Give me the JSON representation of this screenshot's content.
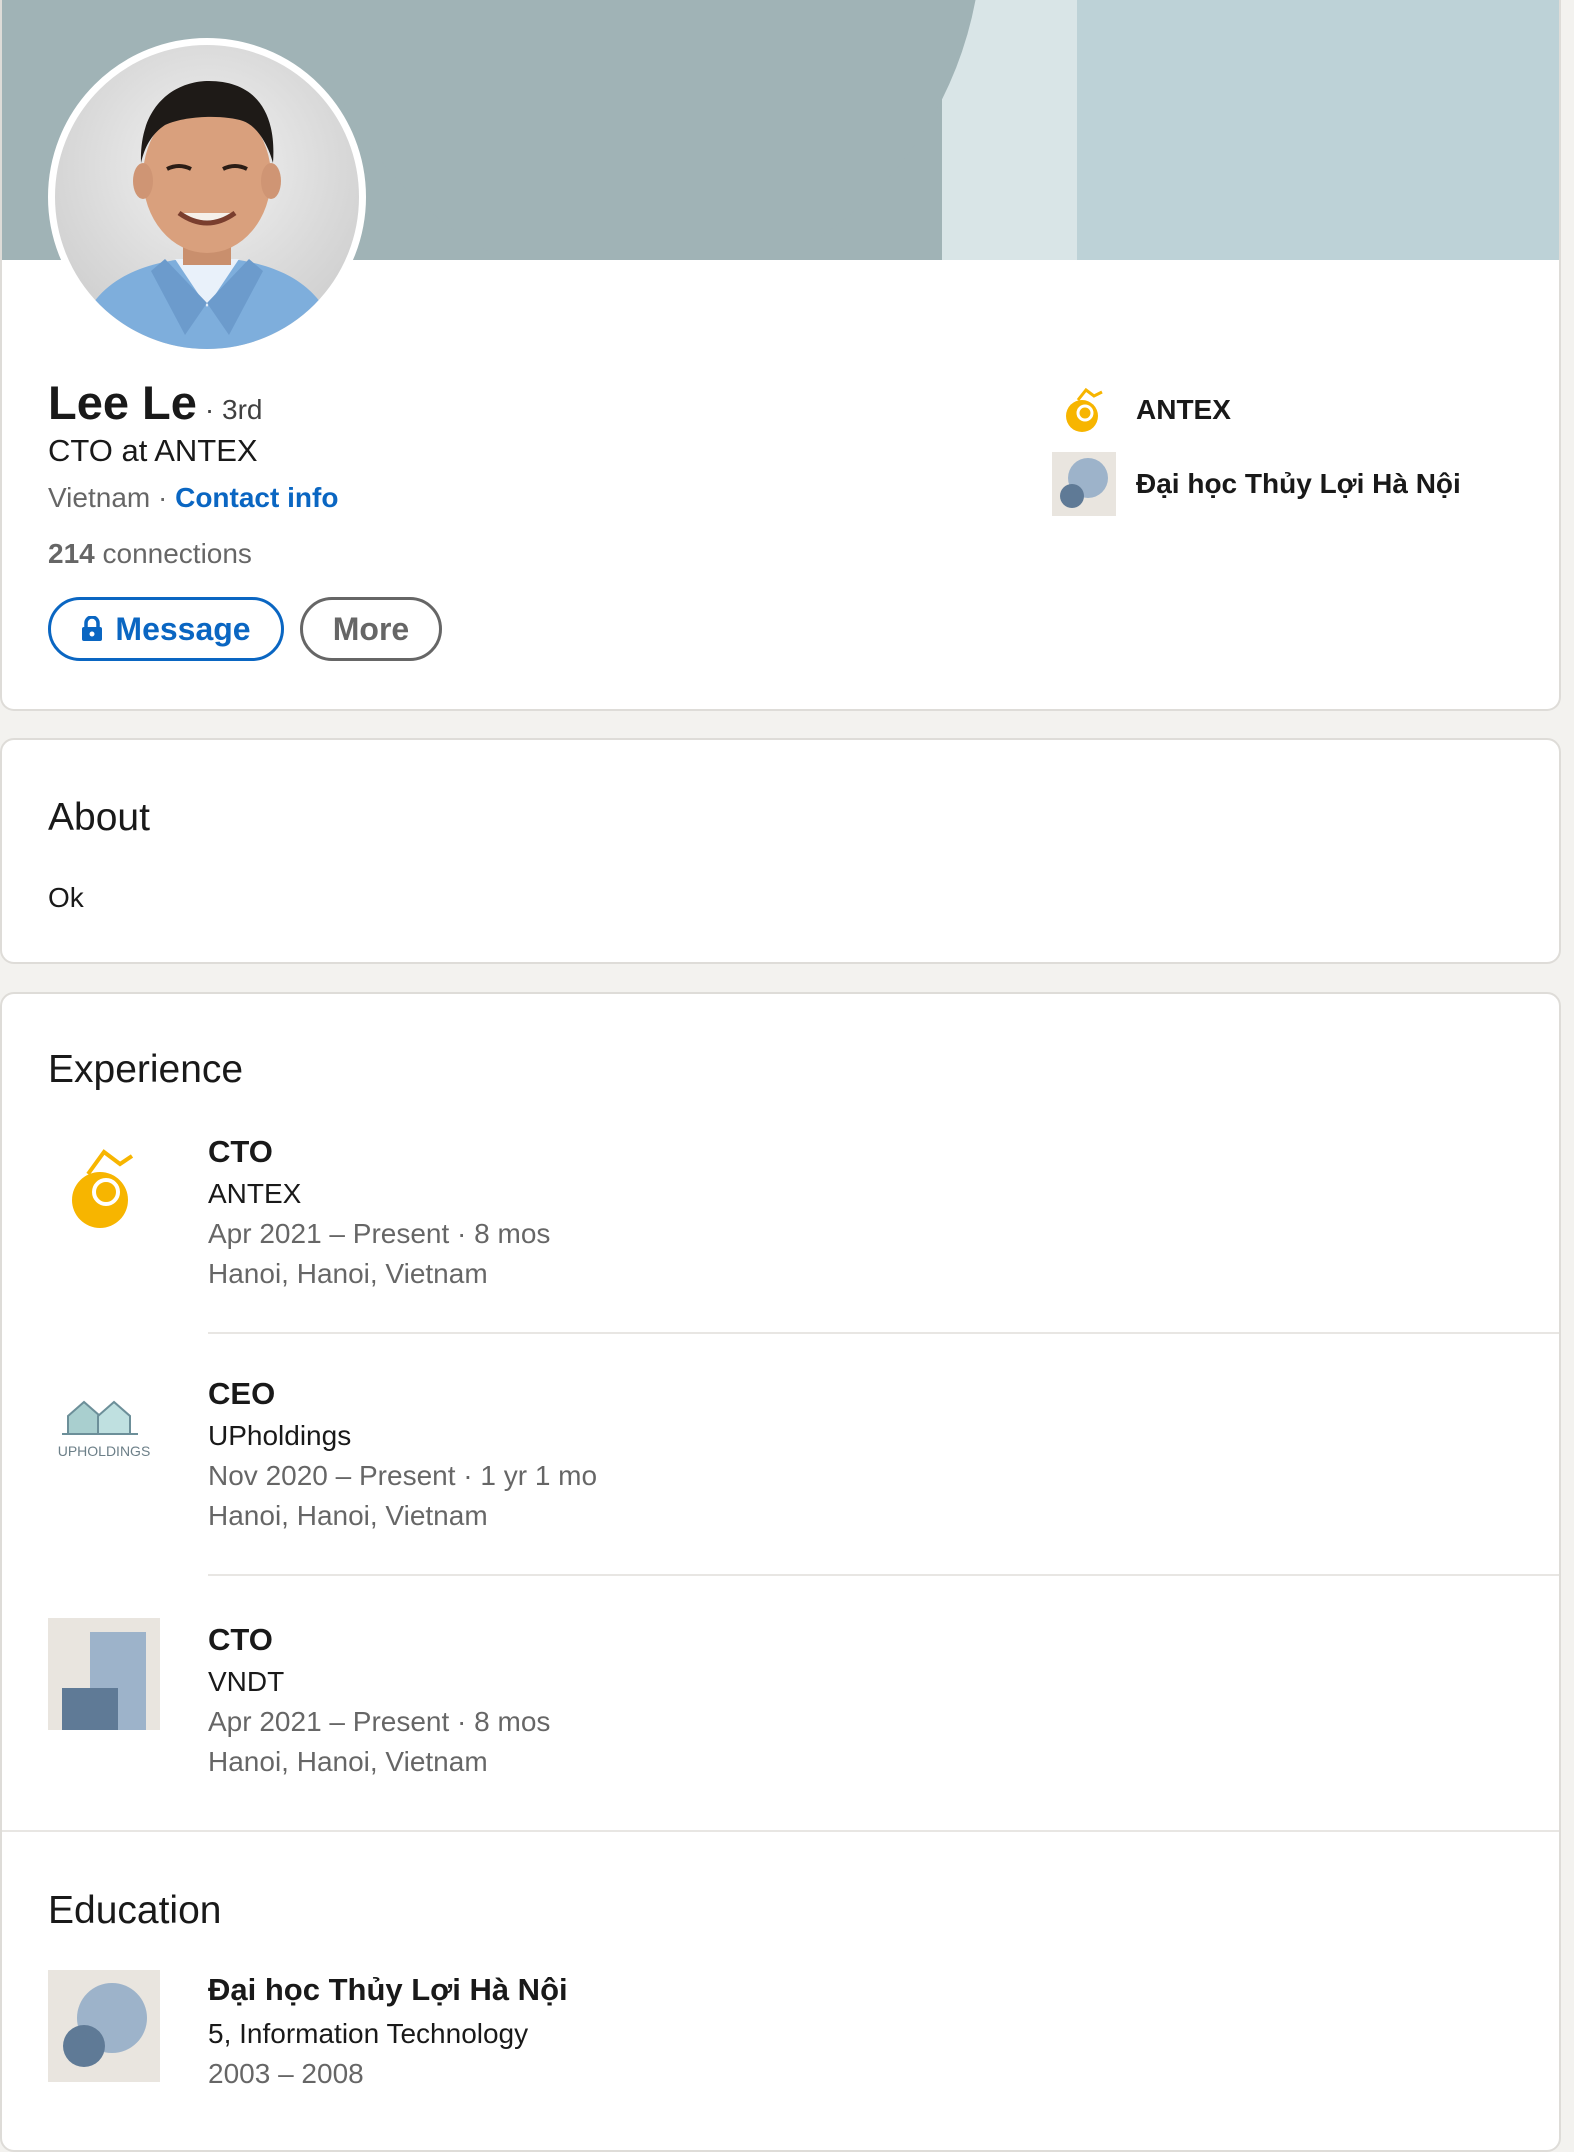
{
  "profile": {
    "name": "Lee Le",
    "degree": "· 3rd",
    "headline": "CTO at ANTEX",
    "location": "Vietnam ·",
    "contact_info": "Contact info",
    "connections_count": "214",
    "connections_label": "connections",
    "message_label": "Message",
    "more_label": "More"
  },
  "affiliations": [
    {
      "label": "ANTEX",
      "logo": "antex-logo"
    },
    {
      "label": "Đại học Thủy Lợi Hà Nội",
      "logo": "school-logo"
    }
  ],
  "about": {
    "title": "About",
    "text": "Ok"
  },
  "experience": {
    "title": "Experience",
    "items": [
      {
        "role": "CTO",
        "org": "ANTEX",
        "dates": "Apr 2021 – Present · 8 mos",
        "place": "Hanoi, Hanoi, Vietnam",
        "logo": "antex-logo"
      },
      {
        "role": "CEO",
        "org": "UPholdings",
        "dates": "Nov 2020 – Present · 1 yr 1 mo",
        "place": "Hanoi, Hanoi, Vietnam",
        "logo": "upholdings-logo",
        "logo_text": "UPHOLDINGS"
      },
      {
        "role": "CTO",
        "org": "VNDT",
        "dates": "Apr 2021 – Present · 8 mos",
        "place": "Hanoi, Hanoi, Vietnam",
        "logo": "company-placeholder-logo"
      }
    ]
  },
  "education": {
    "title": "Education",
    "items": [
      {
        "school": "Đại học Thủy Lợi Hà Nội",
        "degree": "5, Information Technology",
        "years": "2003 – 2008",
        "logo": "school-logo"
      }
    ]
  },
  "colors": {
    "link_blue": "#0a66c2",
    "banner_gray": "#a0b3b6",
    "banner_light": "#d9e5e7",
    "antex_yellow": "#f7b500"
  }
}
